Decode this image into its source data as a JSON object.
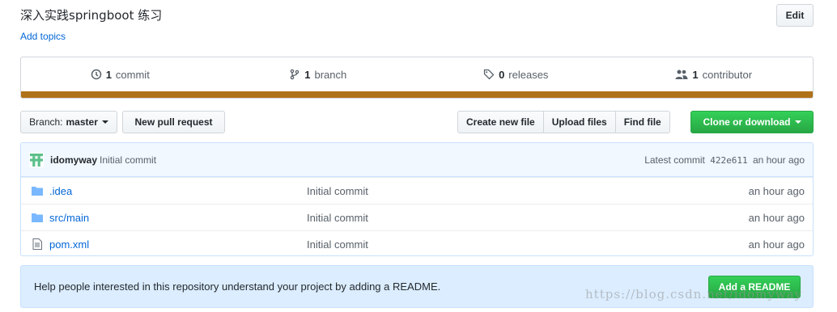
{
  "repo": {
    "description": "深入实践springboot 练习",
    "add_topics": "Add topics",
    "edit_label": "Edit"
  },
  "summary": {
    "commits": {
      "count": "1",
      "label": "commit"
    },
    "branches": {
      "count": "1",
      "label": "branch"
    },
    "releases": {
      "count": "0",
      "label": "releases"
    },
    "contributors": {
      "count": "1",
      "label": "contributor"
    },
    "language_color": "#b07219"
  },
  "toolbar": {
    "branch_prefix": "Branch:",
    "branch_name": "master",
    "new_pr": "New pull request",
    "create_file": "Create new file",
    "upload_files": "Upload files",
    "find_file": "Find file",
    "clone": "Clone or download"
  },
  "latest_commit": {
    "author": "idomyway",
    "message": "Initial commit",
    "prefix": "Latest commit",
    "sha": "422e611",
    "age": "an hour ago"
  },
  "files": [
    {
      "name": ".idea",
      "type": "folder",
      "message": "Initial commit",
      "age": "an hour ago"
    },
    {
      "name": "src/main",
      "type": "folder",
      "message": "Initial commit",
      "age": "an hour ago"
    },
    {
      "name": "pom.xml",
      "type": "file",
      "message": "Initial commit",
      "age": "an hour ago"
    }
  ],
  "readme": {
    "text": "Help people interested in this repository understand your project by adding a README.",
    "button": "Add a README"
  },
  "watermark": "https://blog.csdn.net/idomyway"
}
